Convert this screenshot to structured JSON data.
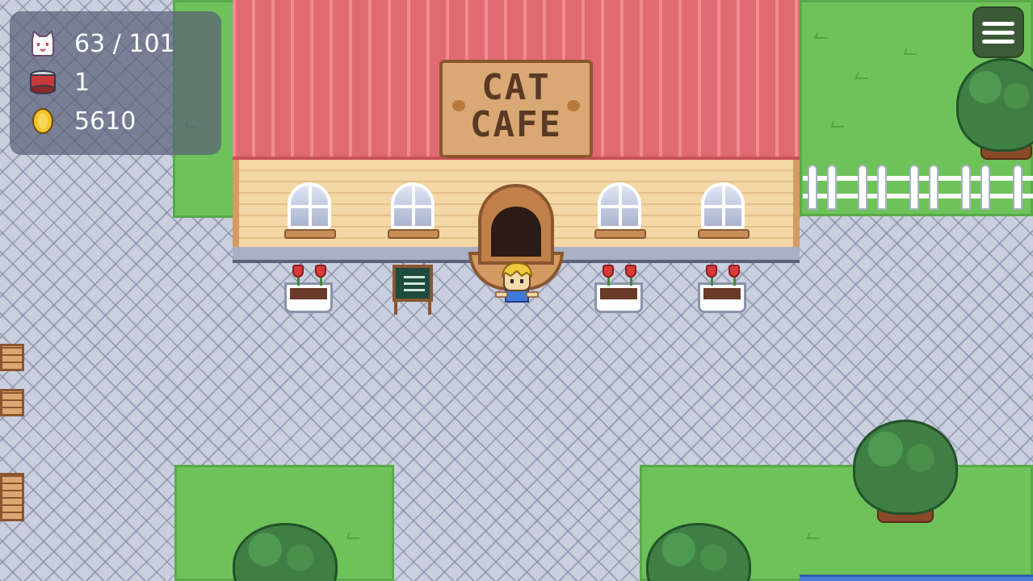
{
  "hud": {
    "cats": {
      "icon": "cat-face-icon",
      "value": "63 / 101"
    },
    "food": {
      "icon": "cat-food-can-icon",
      "value": "1"
    },
    "coins": {
      "icon": "gold-coin-icon",
      "value": "5610"
    }
  },
  "menu": {
    "icon": "hamburger-menu-icon"
  },
  "building": {
    "sign": "CAT\nCAFE"
  },
  "colors": {
    "roof": "#e8727a",
    "grass": "#6ec25a",
    "path": "#c9cfdd",
    "hud_panel": "#5a6078",
    "menu_button": "#3b5a36"
  }
}
